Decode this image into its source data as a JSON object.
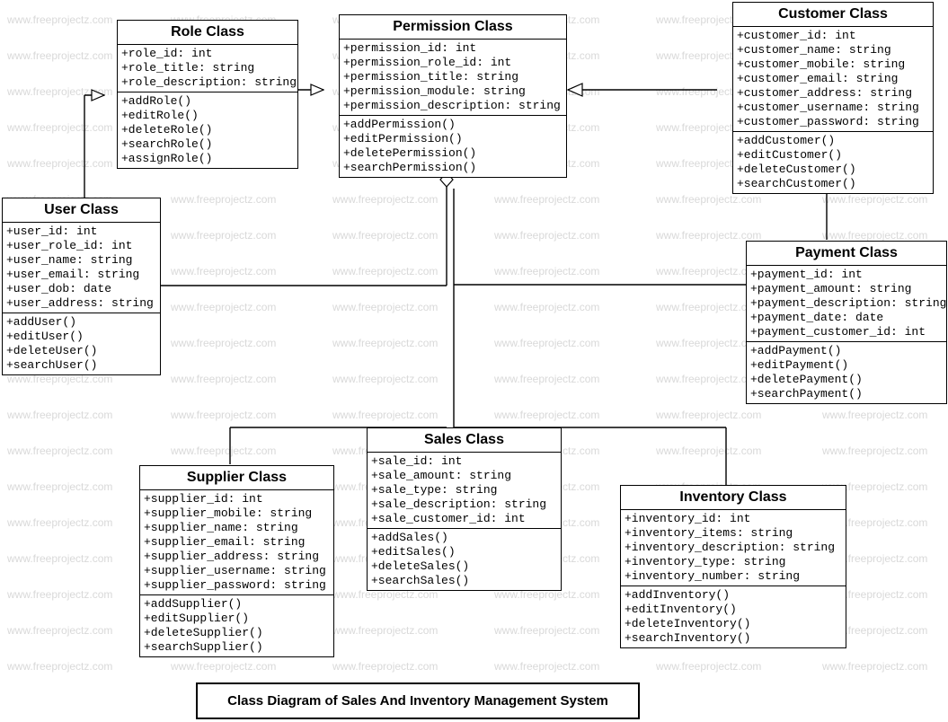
{
  "watermark": "www.freeprojectz.com",
  "caption": "Class Diagram of Sales And Inventory Management System",
  "classes": {
    "role": {
      "title": "Role Class",
      "attrs": [
        "+role_id: int",
        "+role_title: string",
        "+role_description: string"
      ],
      "ops": [
        "+addRole()",
        "+editRole()",
        "+deleteRole()",
        "+searchRole()",
        "+assignRole()"
      ]
    },
    "permission": {
      "title": "Permission Class",
      "attrs": [
        "+permission_id: int",
        "+permission_role_id: int",
        "+permission_title: string",
        "+permission_module: string",
        "+permission_description: string"
      ],
      "ops": [
        "+addPermission()",
        "+editPermission()",
        "+deletePermission()",
        "+searchPermission()"
      ]
    },
    "customer": {
      "title": "Customer Class",
      "attrs": [
        "+customer_id: int",
        "+customer_name: string",
        "+customer_mobile: string",
        "+customer_email: string",
        "+customer_address: string",
        "+customer_username: string",
        "+customer_password: string"
      ],
      "ops": [
        "+addCustomer()",
        "+editCustomer()",
        "+deleteCustomer()",
        "+searchCustomer()"
      ]
    },
    "user": {
      "title": "User Class",
      "attrs": [
        "+user_id: int",
        "+user_role_id: int",
        "+user_name: string",
        "+user_email: string",
        "+user_dob: date",
        "+user_address: string"
      ],
      "ops": [
        "+addUser()",
        "+editUser()",
        "+deleteUser()",
        "+searchUser()"
      ]
    },
    "payment": {
      "title": "Payment Class",
      "attrs": [
        "+payment_id: int",
        "+payment_amount: string",
        "+payment_description: string",
        "+payment_date: date",
        "+payment_customer_id: int"
      ],
      "ops": [
        "+addPayment()",
        "+editPayment()",
        "+deletePayment()",
        "+searchPayment()"
      ]
    },
    "sales": {
      "title": "Sales Class",
      "attrs": [
        "+sale_id: int",
        "+sale_amount: string",
        "+sale_type: string",
        "+sale_description: string",
        "+sale_customer_id: int"
      ],
      "ops": [
        "+addSales()",
        "+editSales()",
        "+deleteSales()",
        "+searchSales()"
      ]
    },
    "supplier": {
      "title": "Supplier Class",
      "attrs": [
        "+supplier_id: int",
        "+supplier_mobile: string",
        "+supplier_name: string",
        "+supplier_email: string",
        "+supplier_address: string",
        "+supplier_username: string",
        "+supplier_password: string"
      ],
      "ops": [
        "+addSupplier()",
        "+editSupplier()",
        "+deleteSupplier()",
        "+searchSupplier()"
      ]
    },
    "inventory": {
      "title": "Inventory Class",
      "attrs": [
        "+inventory_id: int",
        "+inventory_items: string",
        "+inventory_description: string",
        "+inventory_type: string",
        "+inventory_number: string"
      ],
      "ops": [
        "+addInventory()",
        "+editInventory()",
        "+deleteInventory()",
        "+searchInventory()"
      ]
    }
  }
}
